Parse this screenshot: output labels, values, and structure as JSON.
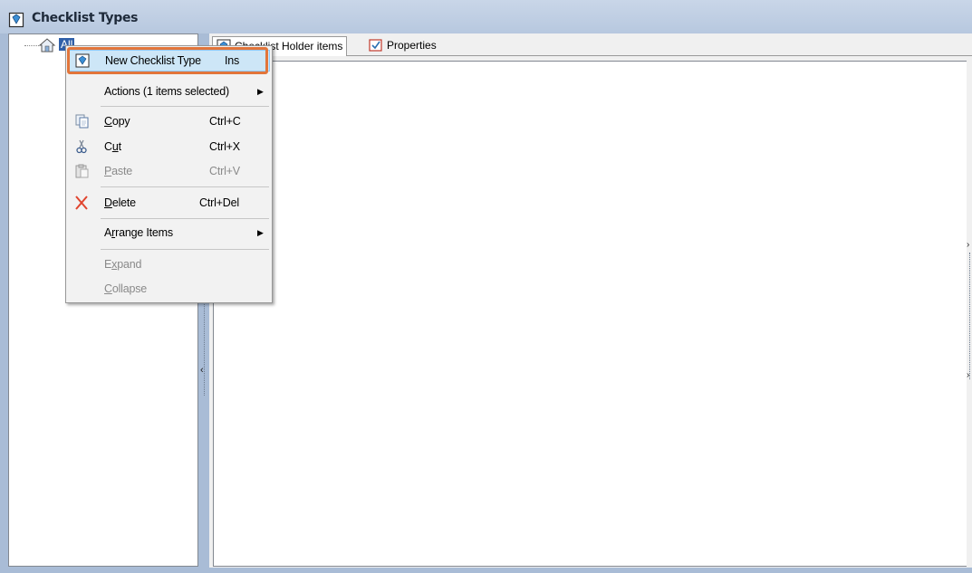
{
  "window": {
    "title": "Checklist Types",
    "title_icon": "checklist-type-icon"
  },
  "tree": {
    "root_label": "All",
    "root_icon": "folder-home-icon"
  },
  "tabs": [
    {
      "label": "Checklist Holder items",
      "icon": "checklist-icon"
    },
    {
      "label": "Properties",
      "icon": "properties-icon"
    }
  ],
  "context_menu": {
    "items": [
      {
        "label": "New Checklist Type",
        "shortcut": "Ins",
        "icon": "new-checklist-icon",
        "highlighted": true
      },
      {
        "label": "Actions (1 items selected)",
        "submenu": true
      },
      {
        "label_prefix": "",
        "mnemonic": "C",
        "label_rest": "opy",
        "shortcut": "Ctrl+C",
        "icon": "copy-icon"
      },
      {
        "label_prefix": "C",
        "mnemonic": "u",
        "label_rest": "t",
        "shortcut": "Ctrl+X",
        "icon": "cut-icon"
      },
      {
        "label_prefix": "",
        "mnemonic": "P",
        "label_rest": "aste",
        "shortcut": "Ctrl+V",
        "icon": "paste-icon",
        "disabled": true
      },
      {
        "label_prefix": "",
        "mnemonic": "D",
        "label_rest": "elete",
        "shortcut": "Ctrl+Del",
        "icon": "delete-icon"
      },
      {
        "label_prefix": "A",
        "mnemonic": "r",
        "label_rest": "range Items",
        "submenu": true
      },
      {
        "label_prefix": "E",
        "mnemonic": "x",
        "label_rest": "pand",
        "disabled": true
      },
      {
        "label_prefix": "",
        "mnemonic": "C",
        "label_rest": "ollapse",
        "disabled": true
      }
    ]
  },
  "colors": {
    "highlight_outline": "#e2753a",
    "menu_hover": "#cde6f7",
    "selection": "#2f5fa8"
  }
}
